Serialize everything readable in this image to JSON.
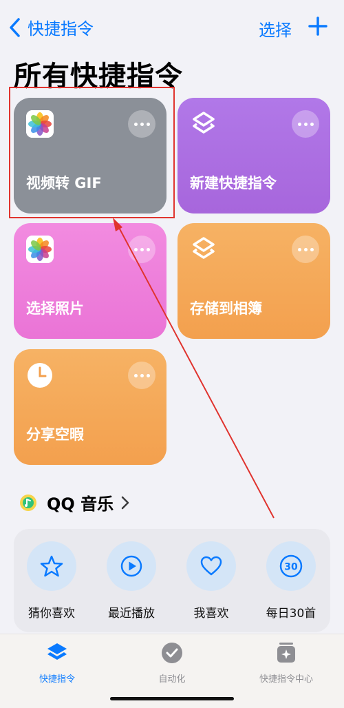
{
  "nav": {
    "back_label": "快捷指令",
    "select_label": "选择"
  },
  "page": {
    "title": "所有快捷指令"
  },
  "shortcuts": [
    {
      "label": "视频转 GIF",
      "icon": "photos-icon",
      "color": "#8b9098",
      "highlighted": true
    },
    {
      "label": "新建快捷指令",
      "icon": "shortcuts-layers-icon",
      "color": "#ac70e2"
    },
    {
      "label": "选择照片",
      "icon": "photos-icon",
      "color": "#ef80db"
    },
    {
      "label": "存储到相簿",
      "icon": "shortcuts-layers-icon",
      "color": "#f4a858"
    },
    {
      "label": "分享空暇",
      "icon": "clock-icon",
      "color": "#f4a858"
    }
  ],
  "qq_music": {
    "title": "QQ 音乐",
    "items": [
      {
        "label": "猜你喜欢",
        "icon": "star-icon"
      },
      {
        "label": "最近播放",
        "icon": "play-icon"
      },
      {
        "label": "我喜欢",
        "icon": "heart-icon"
      },
      {
        "label": "每日30首",
        "icon": "daily-30-icon",
        "badge": "30"
      }
    ]
  },
  "tabs": [
    {
      "label": "快捷指令",
      "icon": "layers-icon",
      "active": true
    },
    {
      "label": "自动化",
      "icon": "clock-check-icon",
      "active": false
    },
    {
      "label": "快捷指令中心",
      "icon": "gallery-icon",
      "active": false
    }
  ],
  "colors": {
    "accent": "#0a7aff",
    "annotation": "#e0332e"
  }
}
